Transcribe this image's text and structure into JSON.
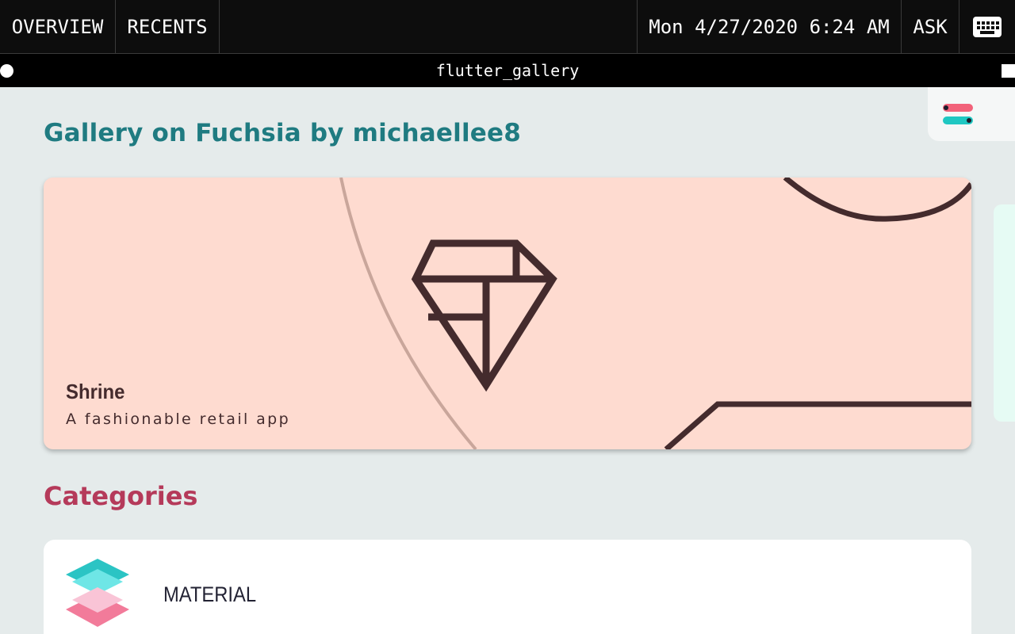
{
  "system_bar": {
    "overview": "OVERVIEW",
    "recents": "RECENTS",
    "datetime": "Mon 4/27/2020 6:24 AM",
    "ask": "ASK",
    "keyboard_icon": "keyboard-icon"
  },
  "window": {
    "title": "flutter_gallery"
  },
  "app": {
    "gallery_title": "Gallery on Fuchsia by michaellee8",
    "settings_icon": "settings-toggle-icon",
    "featured": {
      "name": "Shrine",
      "subtitle": "A fashionable retail app",
      "icon": "diamond-icon",
      "background": "#fedbd0"
    },
    "categories_title": "Categories",
    "categories": [
      {
        "label": "MATERIAL",
        "icon": "material-layers-icon"
      }
    ],
    "colors": {
      "title_teal": "#1f7b81",
      "categories_pink": "#b53a5a",
      "background": "#e5ebeb"
    }
  }
}
